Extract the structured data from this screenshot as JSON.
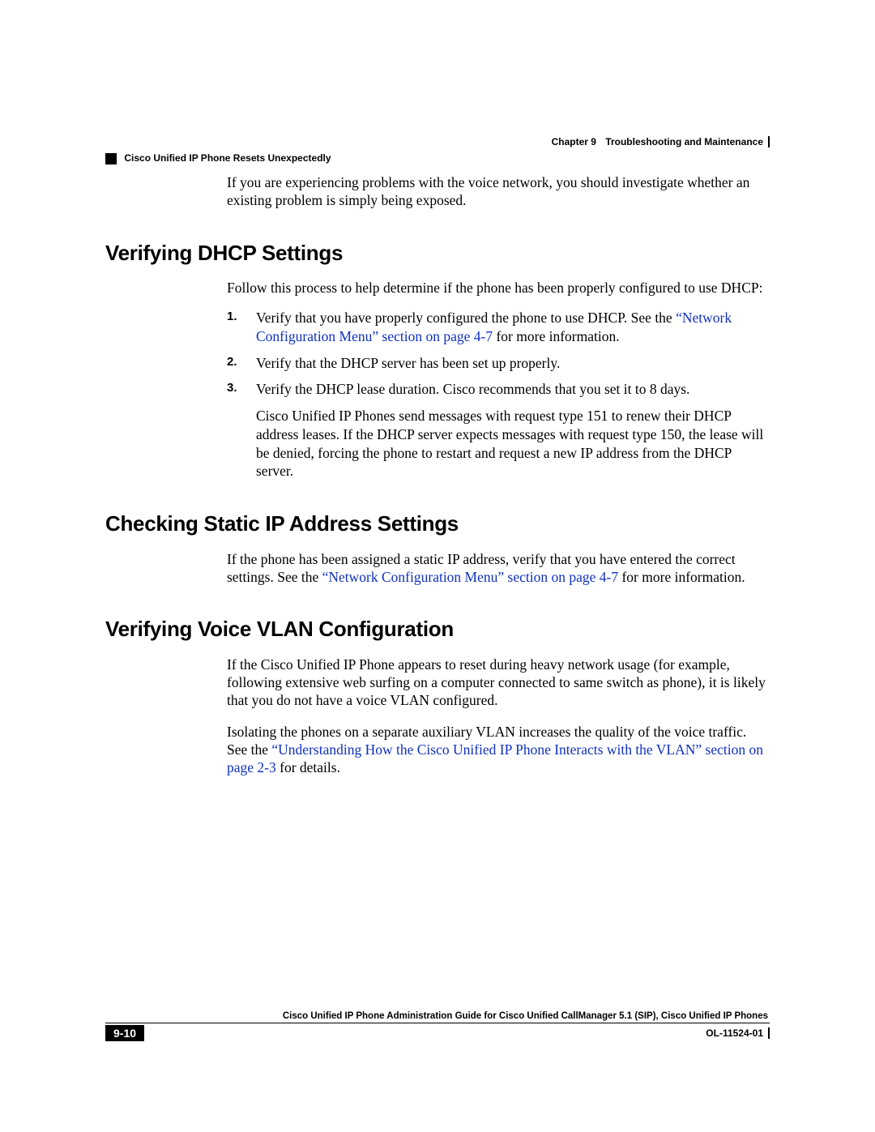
{
  "header": {
    "chapter_label": "Chapter 9",
    "chapter_title": "Troubleshooting and Maintenance",
    "section_title": "Cisco Unified IP Phone Resets Unexpectedly"
  },
  "intro_paragraph": "If you are experiencing problems with the voice network, you should investigate whether an existing problem is simply being exposed.",
  "sections": {
    "dhcp": {
      "heading": "Verifying DHCP Settings",
      "intro": "Follow this process to help determine if the phone has been properly configured to use DHCP:",
      "step1_pre": "Verify that you have properly configured the phone to use DHCP. See the ",
      "step1_link": "“Network Configuration Menu” section on page 4-7",
      "step1_post": " for more information.",
      "step2": "Verify that the DHCP server has been set up properly.",
      "step3": "Verify the DHCP lease duration. Cisco recommends that you set it to 8 days.",
      "step3_para": "Cisco Unified IP Phones send messages with request type 151 to renew their DHCP address leases. If the DHCP server expects messages with request type 150, the lease will be denied, forcing the phone to restart and request a new IP address from the DHCP server."
    },
    "static_ip": {
      "heading": "Checking Static IP Address Settings",
      "para_pre": "If the phone has been assigned a static IP address, verify that you have entered the correct settings. See the ",
      "para_link": "“Network Configuration Menu” section on page 4-7",
      "para_post": " for more information."
    },
    "voice_vlan": {
      "heading": "Verifying Voice VLAN Configuration",
      "para1": "If the Cisco Unified IP Phone appears to reset during heavy network usage (for example, following extensive web surfing on a computer connected to same switch as phone), it is likely that you do not have a voice VLAN configured.",
      "para2_pre": "Isolating the phones on a separate auxiliary VLAN increases the quality of the voice traffic. See the ",
      "para2_link": "“Understanding How the Cisco Unified IP Phone Interacts with the VLAN” section on page 2-3",
      "para2_post": " for details."
    }
  },
  "footer": {
    "guide_title": "Cisco Unified IP Phone Administration Guide for Cisco Unified CallManager 5.1 (SIP), Cisco Unified IP Phones",
    "page_number": "9-10",
    "doc_number": "OL-11524-01"
  },
  "list_numbers": {
    "n1": "1.",
    "n2": "2.",
    "n3": "3."
  }
}
